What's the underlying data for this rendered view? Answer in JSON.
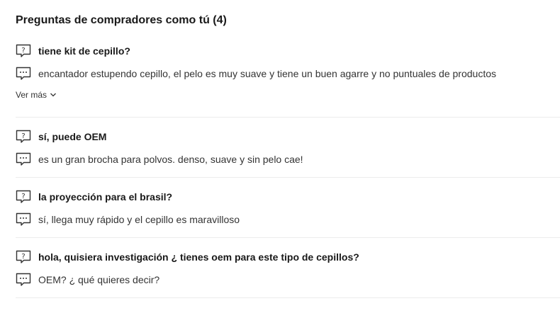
{
  "section": {
    "title": "Preguntas de compradores como tú (4)",
    "see_more_label": "Ver más"
  },
  "items": [
    {
      "question": "tiene kit de cepillo?",
      "answer": "encantador estupendo cepillo, el pelo es muy suave y tiene un buen agarre y no puntuales de productos"
    },
    {
      "question": "sí, puede OEM",
      "answer": "es un gran brocha para polvos. denso, suave y sin pelo cae!"
    },
    {
      "question": "la proyección para el brasil?",
      "answer": "sí, llega muy rápido y el cepillo es maravilloso"
    },
    {
      "question": "hola, quisiera investigación ¿ tienes oem para este tipo de cepillos?",
      "answer": "OEM? ¿ qué quieres decir?"
    }
  ],
  "icons": {
    "question": "question-bubble-icon",
    "answer": "answer-bubble-icon",
    "expand": "chevron-down-icon"
  },
  "colors": {
    "text": "#191919",
    "divider": "#ececec"
  }
}
